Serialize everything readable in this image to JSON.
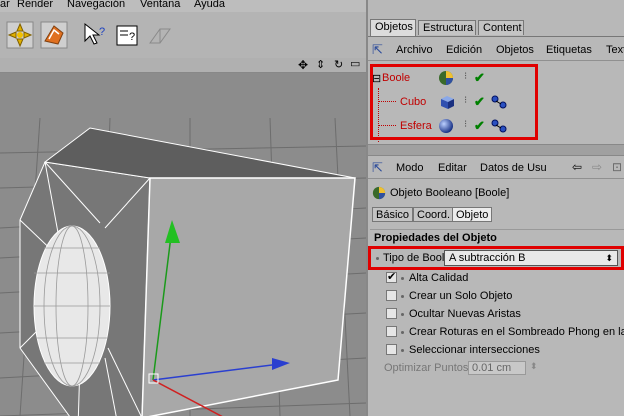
{
  "menubar": {
    "items": [
      "ar",
      "Render",
      "Navegación",
      "Ventana",
      "Ayuda"
    ]
  },
  "right_panel": {
    "tabs": [
      "Objetos",
      "Estructura",
      "Content"
    ],
    "object_menu": [
      "Archivo",
      "Edición",
      "Objetos",
      "Etiquetas",
      "Text"
    ],
    "objects": [
      {
        "name": "Boole",
        "prefix": "⊟"
      },
      {
        "name": "Cubo"
      },
      {
        "name": "Esfera"
      }
    ],
    "attr_menu": [
      "Modo",
      "Editar",
      "Datos de Usu"
    ],
    "attr_title": "Objeto Booleano [Boole]",
    "subtabs": [
      "Básico",
      "Coord.",
      "Objeto"
    ],
    "section_title": "Propiedades del Objeto",
    "boolean_type_label": "Tipo de Booleana",
    "boolean_type_value": "A subtracción B",
    "properties": [
      {
        "label": "Alta Calidad",
        "checked": true
      },
      {
        "label": "Crear un Solo Objeto",
        "checked": false
      },
      {
        "label": "Ocultar Nuevas Aristas",
        "checked": false
      },
      {
        "label": "Crear Roturas en el Sombreado Phong en las",
        "checked": false
      },
      {
        "label": "Seleccionar intersecciones",
        "checked": false
      }
    ],
    "optimize_label": "Optimizar Puntos",
    "optimize_value": "0.01 cm"
  },
  "colors": {
    "highlight": "#e00000",
    "object_name": "#c00000",
    "check": "#008000"
  }
}
